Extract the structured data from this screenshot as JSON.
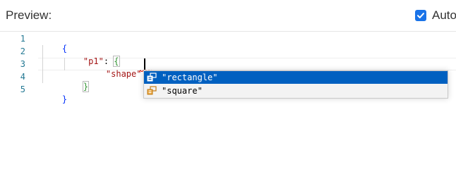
{
  "header": {
    "title": "Preview:",
    "auto_label": "Auto-",
    "auto_checked": true,
    "accent_color": "#1a73e8"
  },
  "editor": {
    "line_numbers": [
      "1",
      "2",
      "3",
      "4",
      "5"
    ],
    "lines": {
      "l1_open": "{",
      "l2_key": "\"p1\"",
      "l2_colon": ":",
      "l2_open": "{",
      "l3_key": "\"shape\"",
      "l3_colon": ":",
      "l3_value": "\"\"",
      "l4_close": "}",
      "l5_close": "}"
    },
    "colors": {
      "line_number": "#237893",
      "key": "#a31515",
      "brace_level1": "#0431fa",
      "brace_level2": "#319331"
    }
  },
  "suggestions": {
    "items": [
      {
        "label": "\"rectangle\"",
        "icon": "enum-member-icon",
        "selected": true
      },
      {
        "label": "\"square\"",
        "icon": "enum-member-icon",
        "selected": false
      }
    ],
    "selected_color": "#0060c0"
  }
}
